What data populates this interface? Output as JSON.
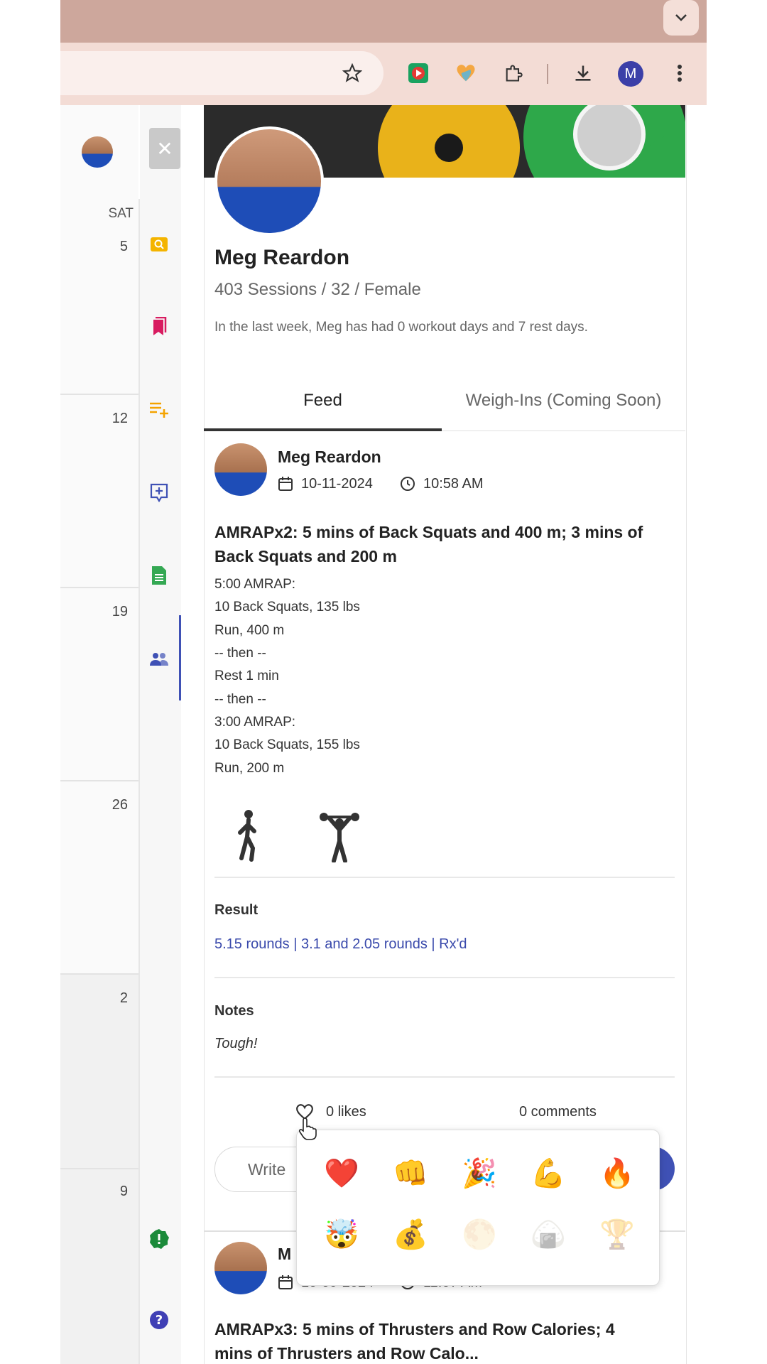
{
  "profile": {
    "name": "Meg Reardon",
    "stats": "403 Sessions / 32 / Female",
    "summary": "In the last week, Meg has had 0 workout days and 7 rest days."
  },
  "tabs": [
    {
      "label": "Feed",
      "active": true
    },
    {
      "label": "Weigh-Ins (Coming Soon)",
      "active": false
    }
  ],
  "calendar": {
    "day_header": "SAT",
    "dates": [
      "5",
      "12",
      "19",
      "26",
      "2",
      "9"
    ]
  },
  "toolbar": {
    "avatar_letter": "M"
  },
  "post": {
    "author": "Meg Reardon",
    "date": "10-11-2024",
    "time": "10:58 AM",
    "title_line1": "AMRAPx2: 5 mins of Back Squats and 400 m; 3 mins of",
    "title_line2": "Back Squats and 200 m",
    "workout_lines": [
      "5:00 AMRAP:",
      "10 Back Squats, 135 lbs",
      "Run, 400 m",
      "-- then --",
      "Rest 1 min",
      "-- then --",
      "3:00 AMRAP:",
      "10 Back Squats, 155 lbs",
      "Run, 200 m"
    ],
    "result_heading": "Result",
    "result_value": "5.15 rounds | 3.1 and 2.05 rounds | Rx'd",
    "notes_heading": "Notes",
    "notes_value": "Tough!",
    "likes": "0 likes",
    "comments": "0 comments",
    "comment_placeholder": "Write"
  },
  "next_post": {
    "author": "M",
    "date": "10-09-2024",
    "time": "11:07 AM",
    "title_line1": "AMRAPx3: 5 mins of Thrusters and Row Calories; 4",
    "title_line2": "mins of Thrusters and Row Calo..."
  },
  "reactions": [
    "❤️",
    "👊",
    "🎉",
    "💪",
    "🔥",
    "🤯",
    "💰",
    "🌕",
    "🍙",
    "🏆"
  ],
  "colors": {
    "accent": "#3f51b5",
    "result_link": "#3949ab",
    "heart": "#e53935"
  }
}
